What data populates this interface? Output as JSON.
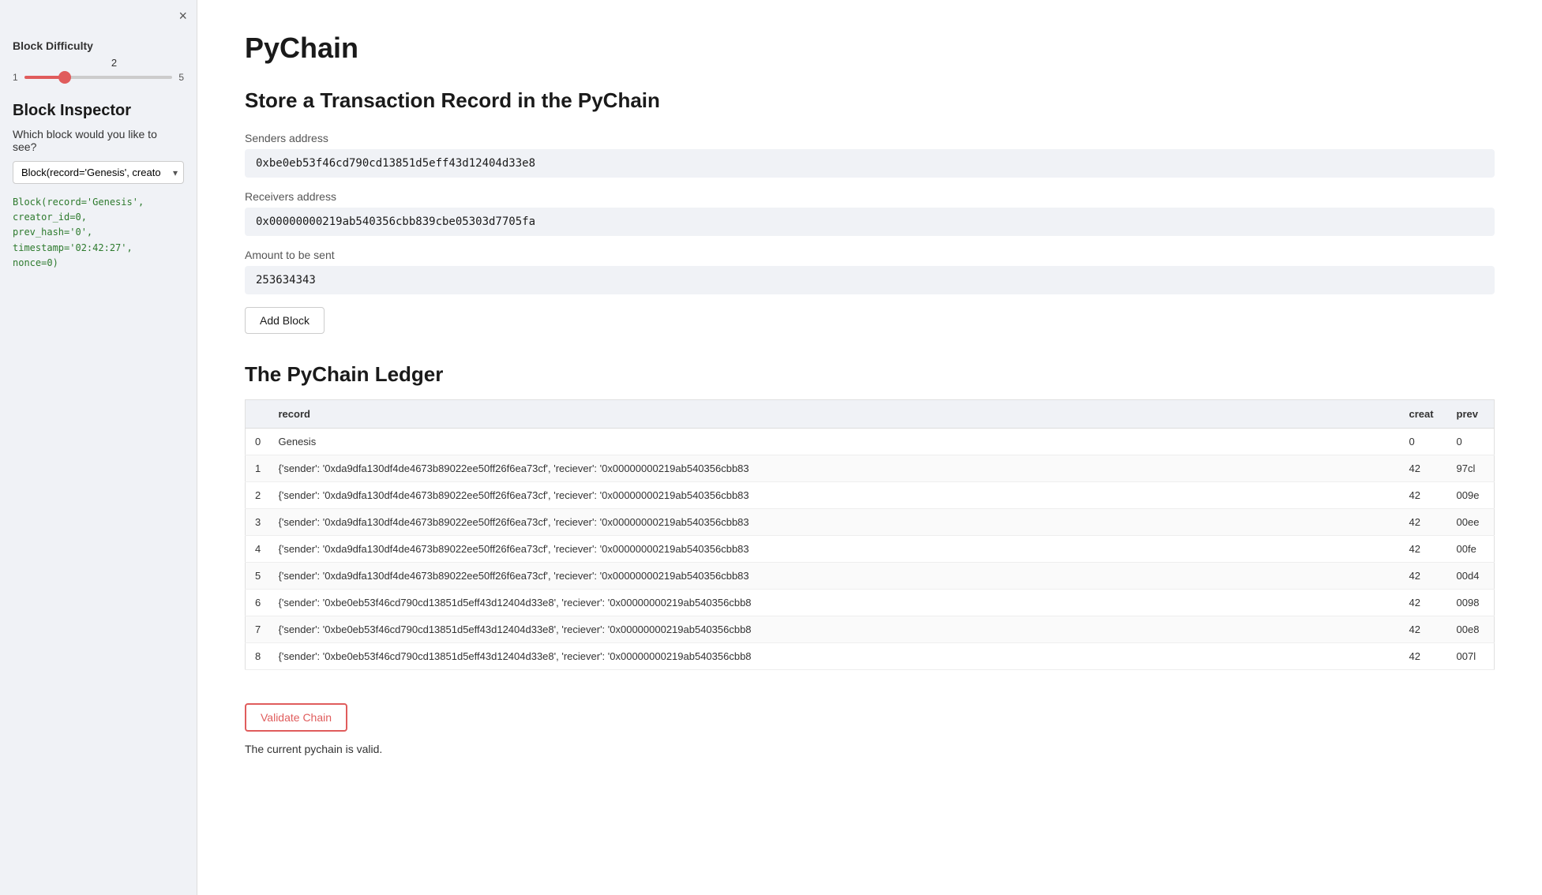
{
  "sidebar": {
    "close_label": "×",
    "block_difficulty_label": "Block Difficulty",
    "slider_value": "2",
    "slider_min": "1",
    "slider_max": "5",
    "slider_current": 2,
    "block_inspector_title": "Block Inspector",
    "block_inspector_question": "Which block would you like to see?",
    "dropdown_value": "Block(record='Genesis', creator_id=...",
    "block_details_line1": "Block(record='Genesis', creator_id=0,",
    "block_details_line2": "prev_hash='0', timestamp='02:42:27',",
    "block_details_line3": "nonce=0)"
  },
  "main": {
    "app_title": "PyChain",
    "transaction_section_title": "Store a Transaction Record in the PyChain",
    "sender_label": "Senders address",
    "sender_value": "0xbe0eb53f46cd790cd13851d5eff43d12404d33e8",
    "receiver_label": "Receivers address",
    "receiver_value": "0x00000000219ab540356cbb839cbe05303d7705fa",
    "amount_label": "Amount to be sent",
    "amount_value": "253634343",
    "add_block_label": "Add Block",
    "ledger_title": "The PyChain Ledger",
    "table": {
      "headers": [
        "",
        "record",
        "creat",
        "prev"
      ],
      "rows": [
        {
          "index": "0",
          "record": "Genesis",
          "creator": "0",
          "prev": "0"
        },
        {
          "index": "1",
          "record": "{'sender': '0xda9dfa130df4de4673b89022ee50ff26f6ea73cf', 'reciever': '0x00000000219ab540356cbb83",
          "creator": "42",
          "prev": "97cl"
        },
        {
          "index": "2",
          "record": "{'sender': '0xda9dfa130df4de4673b89022ee50ff26f6ea73cf', 'reciever': '0x00000000219ab540356cbb83",
          "creator": "42",
          "prev": "009e"
        },
        {
          "index": "3",
          "record": "{'sender': '0xda9dfa130df4de4673b89022ee50ff26f6ea73cf', 'reciever': '0x00000000219ab540356cbb83",
          "creator": "42",
          "prev": "00ee"
        },
        {
          "index": "4",
          "record": "{'sender': '0xda9dfa130df4de4673b89022ee50ff26f6ea73cf', 'reciever': '0x00000000219ab540356cbb83",
          "creator": "42",
          "prev": "00fe"
        },
        {
          "index": "5",
          "record": "{'sender': '0xda9dfa130df4de4673b89022ee50ff26f6ea73cf', 'reciever': '0x00000000219ab540356cbb83",
          "creator": "42",
          "prev": "00d4"
        },
        {
          "index": "6",
          "record": "{'sender': '0xbe0eb53f46cd790cd13851d5eff43d12404d33e8', 'reciever': '0x00000000219ab540356cbb8",
          "creator": "42",
          "prev": "0098"
        },
        {
          "index": "7",
          "record": "{'sender': '0xbe0eb53f46cd790cd13851d5eff43d12404d33e8', 'reciever': '0x00000000219ab540356cbb8",
          "creator": "42",
          "prev": "00e8"
        },
        {
          "index": "8",
          "record": "{'sender': '0xbe0eb53f46cd790cd13851d5eff43d12404d33e8', 'reciever': '0x00000000219ab540356cbb8",
          "creator": "42",
          "prev": "007l"
        }
      ]
    },
    "validate_label": "Validate Chain",
    "valid_message": "The current pychain is valid."
  }
}
